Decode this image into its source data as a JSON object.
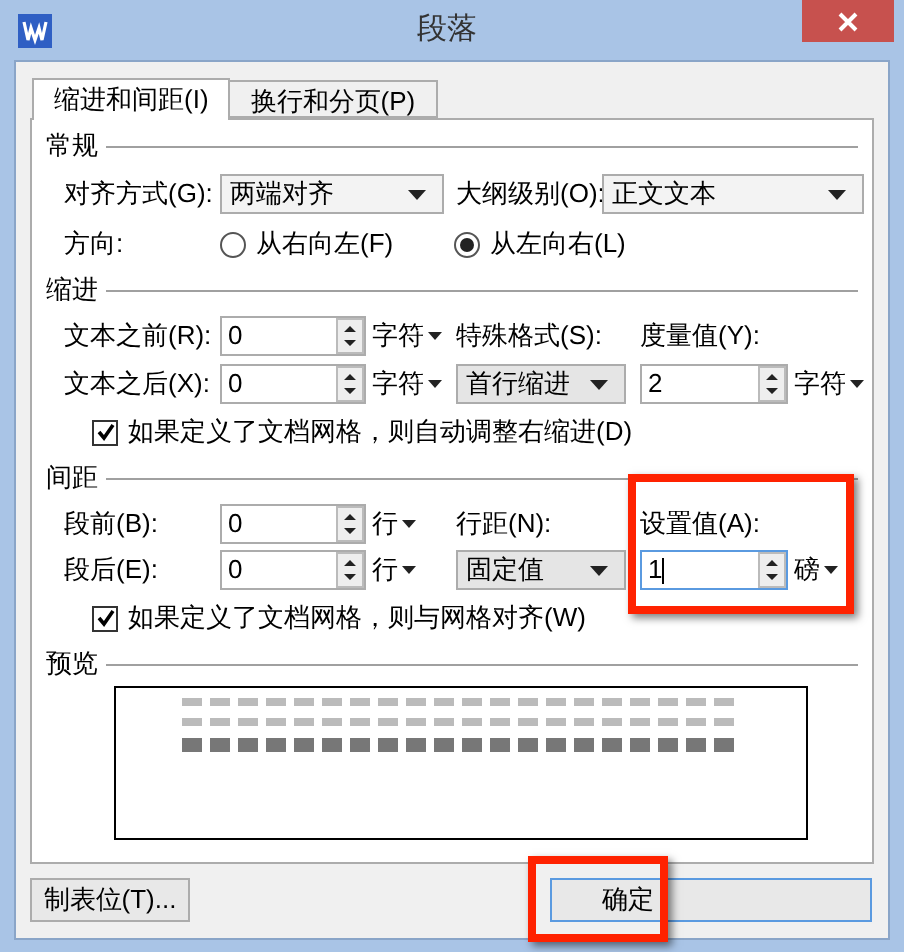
{
  "window": {
    "title": "段落"
  },
  "tabs": [
    {
      "label": "缩进和间距(I)",
      "selected": true
    },
    {
      "label": "换行和分页(P)",
      "selected": false
    }
  ],
  "general": {
    "heading": "常规",
    "alignment": {
      "label": "对齐方式(G):",
      "value": "两端对齐"
    },
    "outline": {
      "label": "大纲级别(O):",
      "value": "正文文本"
    },
    "direction": {
      "label": "方向:",
      "options": [
        {
          "label": "从右向左(F)",
          "selected": false
        },
        {
          "label": "从左向右(L)",
          "selected": true
        }
      ]
    }
  },
  "indent": {
    "heading": "缩进",
    "before": {
      "label": "文本之前(R):",
      "value": "0",
      "unit": "字符"
    },
    "after": {
      "label": "文本之后(X):",
      "value": "0",
      "unit": "字符"
    },
    "special": {
      "label": "特殊格式(S):",
      "value": "首行缩进"
    },
    "measure": {
      "label": "度量值(Y):",
      "value": "2",
      "unit": "字符"
    },
    "auto_adjust": {
      "label": "如果定义了文档网格，则自动调整右缩进(D)",
      "checked": true
    }
  },
  "spacing": {
    "heading": "间距",
    "before": {
      "label": "段前(B):",
      "value": "0",
      "unit": "行"
    },
    "after": {
      "label": "段后(E):",
      "value": "0",
      "unit": "行"
    },
    "line_spacing": {
      "label": "行距(N):",
      "value": "固定值"
    },
    "setting": {
      "label": "设置值(A):",
      "value": "1",
      "unit": "磅",
      "highlighted": true
    },
    "snap": {
      "label": "如果定义了文档网格，则与网格对齐(W)",
      "checked": true
    }
  },
  "preview": {
    "heading": "预览"
  },
  "buttons": [
    {
      "label": "制表位(T)...",
      "highlighted": false
    },
    {
      "label": "确定",
      "highlighted": true
    }
  ]
}
